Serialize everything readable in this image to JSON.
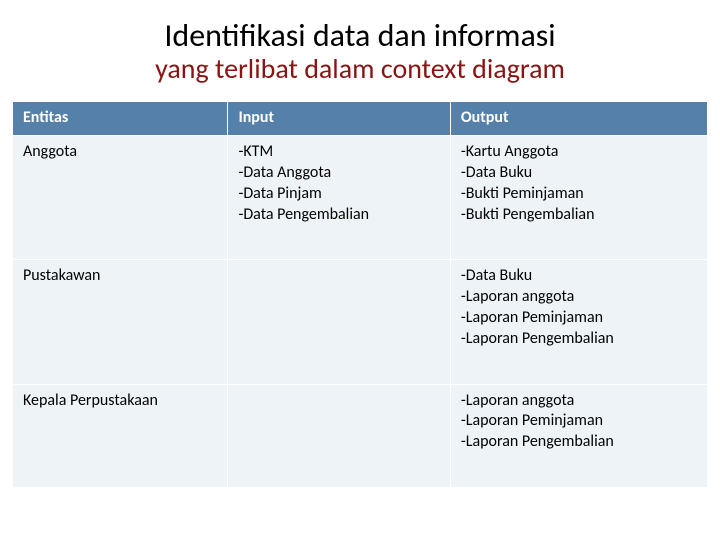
{
  "title": {
    "line1": "Identifikasi data dan informasi",
    "line2": "yang terlibat dalam context diagram"
  },
  "table": {
    "headers": {
      "entitas": "Entitas",
      "input": "Input",
      "output": "Output"
    },
    "rows": [
      {
        "entitas": "Anggota",
        "input": "-KTM\n-Data Anggota\n-Data Pinjam\n-Data Pengembalian",
        "output": "-Kartu Anggota\n-Data Buku\n-Bukti Peminjaman\n-Bukti Pengembalian"
      },
      {
        "entitas": "Pustakawan",
        "input": "",
        "output": "-Data Buku\n-Laporan anggota\n-Laporan Peminjaman\n-Laporan Pengembalian"
      },
      {
        "entitas": "Kepala Perpustakaan",
        "input": "",
        "output": "-Laporan anggota\n-Laporan Peminjaman\n-Laporan Pengembalian"
      }
    ]
  }
}
